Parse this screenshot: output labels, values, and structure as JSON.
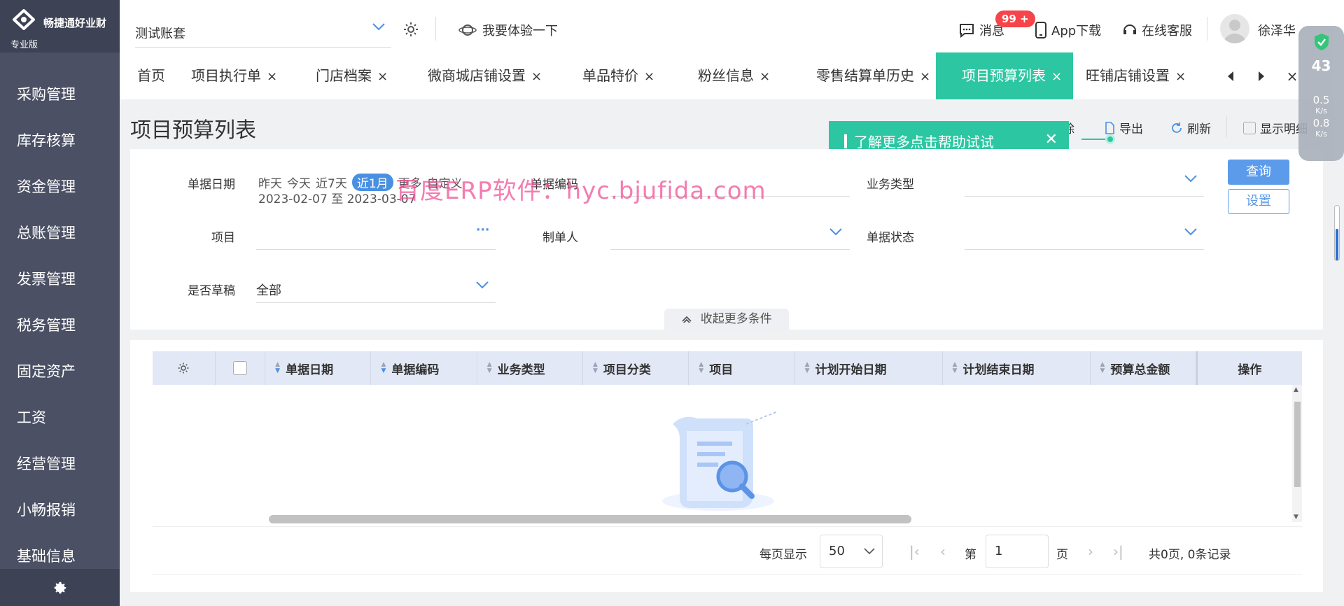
{
  "brand": {
    "name": "畅捷通好业财",
    "edition": "专业版"
  },
  "sidebar": {
    "items": [
      "采购管理",
      "库存核算",
      "资金管理",
      "总账管理",
      "发票管理",
      "税务管理",
      "固定资产",
      "工资",
      "经营管理",
      "小畅报销",
      "基础信息"
    ]
  },
  "topbar": {
    "account": "测试账套",
    "try_label": "我要体验一下",
    "messages_label": "消息",
    "badge": "99 +",
    "app_download": "App下载",
    "support": "在线客服",
    "user": "徐泽华"
  },
  "tabs": [
    {
      "label": "首页",
      "closable": false
    },
    {
      "label": "项目执行单",
      "closable": true
    },
    {
      "label": "门店档案",
      "closable": true
    },
    {
      "label": "微商城店铺设置",
      "closable": true
    },
    {
      "label": "单品特价",
      "closable": true
    },
    {
      "label": "粉丝信息",
      "closable": true
    },
    {
      "label": "零售结算单历史",
      "closable": true
    },
    {
      "label": "项目预算列表",
      "closable": true,
      "active": true
    },
    {
      "label": "旺铺店铺设置",
      "closable": true
    }
  ],
  "tab_close": "×",
  "page": {
    "title": "项目预算列表"
  },
  "toolbar": {
    "delete_tail": "除",
    "export": "导出",
    "refresh": "刷新",
    "show_detail": "显示明细"
  },
  "toast": {
    "text": "了解更多点击帮助试试",
    "close": "✕"
  },
  "filters": {
    "date_label": "单据日期",
    "date_chips": [
      "昨天",
      "今天",
      "近7天",
      "近1月",
      "更多",
      "自定义"
    ],
    "date_selected": "近1月",
    "date_range": "2023-02-07 至 2023-03-07",
    "code_label": "单据编码",
    "biz_type_label": "业务类型",
    "project_label": "项目",
    "project_more": "···",
    "creator_label": "制单人",
    "status_label": "单据状态",
    "draft_label": "是否草稿",
    "draft_value": "全部",
    "query_button": "查询",
    "settings_button": "设置",
    "collapse_label": "收起更多条件"
  },
  "watermark": "百度ERP软件：hyc.bjufida.com",
  "table": {
    "columns": [
      "单据日期",
      "单据编码",
      "业务类型",
      "项目分类",
      "项目",
      "计划开始日期",
      "计划结束日期",
      "预算总金额",
      "操作"
    ]
  },
  "pager": {
    "per_page_label": "每页显示",
    "per_page_value": "50",
    "page_prefix": "第",
    "page_value": "1",
    "page_suffix": "页",
    "summary": "共0页, 0条记录"
  },
  "widget": {
    "score": "43",
    "up": "0.5",
    "down": "0.8",
    "unit": "K/s"
  },
  "colors": {
    "accent": "#2cc7a2",
    "primary": "#4a90e2",
    "sidebar": "#4b5064",
    "badge": "#f5454b"
  }
}
